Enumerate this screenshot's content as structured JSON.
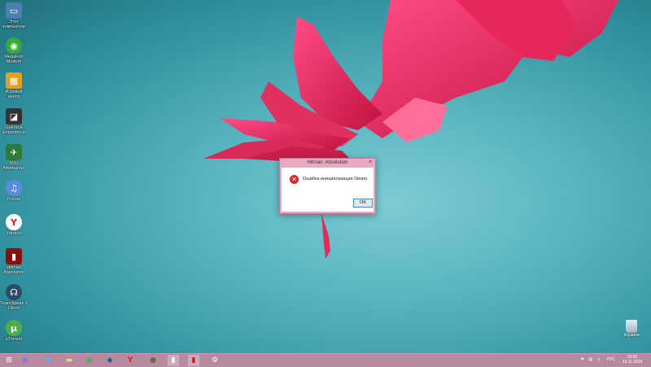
{
  "desktop": {
    "icons": [
      {
        "label": "Этот\nкомпьютер",
        "icon": "computer-icon",
        "color": "#4a7fb0"
      },
      {
        "label": "MegaFon\nModem",
        "icon": "megafon-icon",
        "color": "#3aa83a"
      },
      {
        "label": "Игровой\nцентр",
        "icon": "game-center-icon",
        "color": "#e0a020"
      },
      {
        "label": "GeForce\nExperience",
        "icon": "geforce-icon",
        "color": "#333333"
      },
      {
        "label": "MSI\nAfterburner",
        "icon": "msi-afterburner-icon",
        "color": "#2f7a3a"
      },
      {
        "label": "iTunes",
        "icon": "itunes-icon",
        "color": "#5a8de0"
      },
      {
        "label": "Yandex",
        "icon": "yandex-icon",
        "color": "#e02020"
      },
      {
        "label": "Hitman\nAbsolution",
        "icon": "hitman-icon",
        "color": "#8a1010"
      },
      {
        "label": "TeamSpeak 3\nClient",
        "icon": "teamspeak-icon",
        "color": "#2c4a6a"
      },
      {
        "label": "µTorrent",
        "icon": "utorrent-icon",
        "color": "#4bb04b"
      }
    ],
    "recycle_bin": {
      "label": "Корзина",
      "icon": "recycle-bin-icon"
    }
  },
  "dialog": {
    "title": "Hitman: Absolution",
    "message": "Ошибка инициализации Steam.",
    "ok_label": "OK",
    "icon": "error-icon",
    "close_label": "×"
  },
  "taskbar": {
    "buttons": [
      {
        "name": "start-button",
        "icon": "windows-logo-icon",
        "glyph": "⊞"
      },
      {
        "name": "cortana-button",
        "icon": "mic-icon",
        "glyph": "●"
      },
      {
        "name": "ie-button",
        "icon": "internet-explorer-icon",
        "glyph": "e"
      },
      {
        "name": "explorer-button",
        "icon": "folder-icon",
        "glyph": "▬"
      },
      {
        "name": "store-button",
        "icon": "store-icon",
        "glyph": "▣"
      },
      {
        "name": "app-button",
        "icon": "app-icon",
        "glyph": "◆"
      },
      {
        "name": "yandex-button",
        "icon": "yandex-icon",
        "glyph": "Y"
      },
      {
        "name": "grenade-button",
        "icon": "grenade-icon",
        "glyph": "●"
      },
      {
        "name": "monitor-button",
        "icon": "monitor-icon",
        "glyph": "▮"
      },
      {
        "name": "hitman-button",
        "icon": "hitman-icon",
        "glyph": "▮"
      },
      {
        "name": "settings-button",
        "icon": "gear-icon",
        "glyph": "⚙"
      }
    ],
    "tray": {
      "language": "РУС",
      "time": "10:05",
      "date": "19.11.2018"
    }
  },
  "colors": {
    "dialog_frame": "#e9a9c3",
    "taskbar": "#b88aa0",
    "error": "#d72828"
  }
}
